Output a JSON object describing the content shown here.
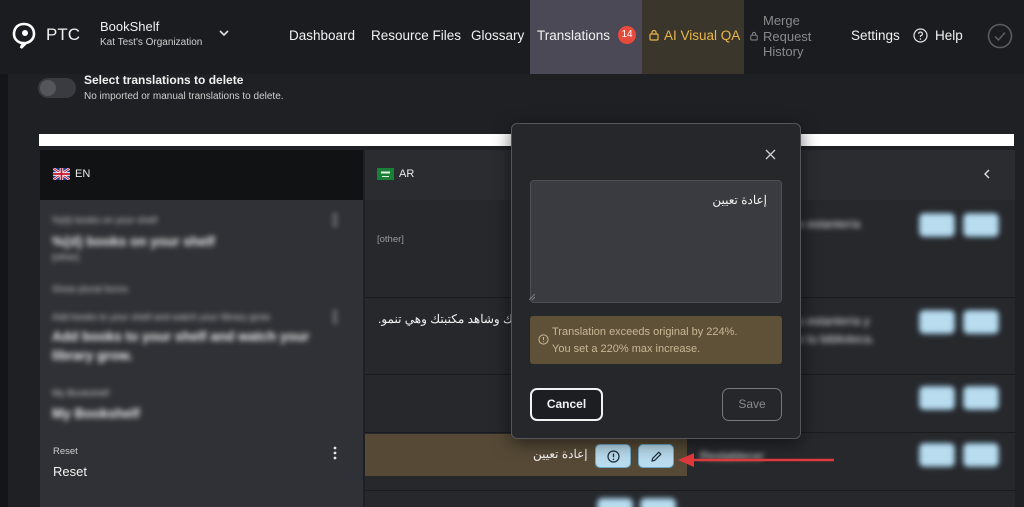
{
  "brand": {
    "name": "PTC",
    "logo_icon": "ptc-logo-icon"
  },
  "project": {
    "name": "BookShelf",
    "org": "Kat Test's Organization"
  },
  "nav": {
    "dashboard": "Dashboard",
    "resource_files": "Resource Files",
    "glossary": "Glossary",
    "translations": "Translations",
    "translations_badge": "14",
    "ai_visual_qa": "AI Visual QA",
    "merge_request_history": "Merge Request History",
    "settings": "Settings",
    "help": "Help"
  },
  "delete_toggle": {
    "title": "Select translations to delete",
    "subtitle": "No imported or manual translations to delete."
  },
  "table": {
    "columns": [
      {
        "code": "EN",
        "flag": "uk-flag-icon"
      },
      {
        "code": "AR",
        "flag": "saudi-flag-icon"
      }
    ],
    "rows": [
      {
        "key": "%{d} books on your shelf",
        "source": "%{d} books on your shelf",
        "plural_tag": "[other]",
        "show_plurals": "Show plural forms",
        "ar": "[other]",
        "es": "e estantería"
      },
      {
        "key": "Add books to your shelf and watch your library grow",
        "source": "Add books to your shelf and watch your library grow.",
        "ar": "أضف كتبًا إلى رفك وشاهد مكتبتك وهي تنمو.",
        "es": "u estantería y\ne tu biblioteca."
      },
      {
        "key": "My Bookshelf",
        "source": "My Bookshelf"
      },
      {
        "key": "Reset",
        "source": "Reset",
        "ar": "إعادة تعيين",
        "es": "Restablecer"
      }
    ]
  },
  "modal": {
    "textarea_value": "إعادة تعيين",
    "warning_line1": "Translation exceeds original by 224%.",
    "warning_line2": "You set a 220% max increase.",
    "cancel": "Cancel",
    "save": "Save"
  },
  "colors": {
    "accent_badge": "#e64b3c",
    "ai_qa_text": "#e8b64a",
    "highlight_row": "#564a36",
    "arrow": "#e0393b"
  }
}
